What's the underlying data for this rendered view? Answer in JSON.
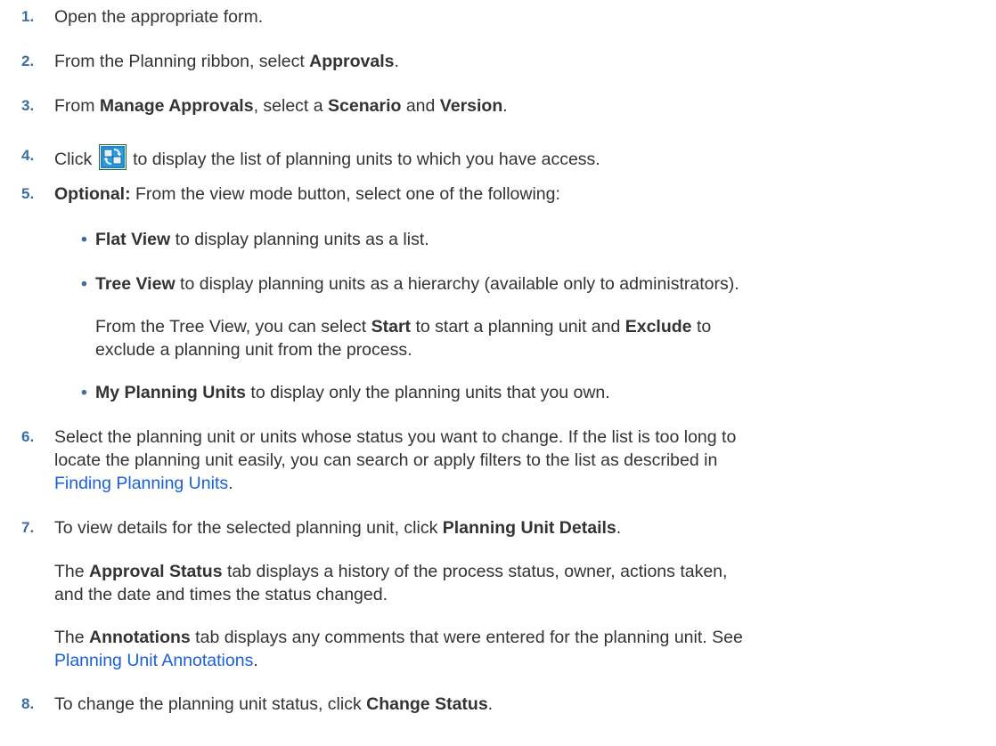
{
  "steps": [
    {
      "num": "1.",
      "text": "Open the appropriate form."
    },
    {
      "num": "2.",
      "pre": "From the Planning ribbon, select ",
      "b1": "Approvals",
      "post": "."
    },
    {
      "num": "3.",
      "pre": "From ",
      "b1": "Manage Approvals",
      "mid1": ", select a ",
      "b2": "Scenario",
      "mid2": " and ",
      "b3": "Version",
      "post": "."
    },
    {
      "num": "4.",
      "pre": "Click ",
      "post": " to display the list of planning units to which you have access.",
      "icon": "refresh-icon"
    },
    {
      "num": "5.",
      "b1": "Optional:",
      "post": " From the view mode button, select one of the following:"
    },
    {
      "num": "6.",
      "line1": "Select the planning unit or units whose status you want to change. If the list is too long to",
      "line2": "locate the planning unit easily, you can search or apply filters to the list as described in",
      "link": "Finding Planning Units",
      "post": "."
    },
    {
      "num": "7.",
      "pre": "To view details for the selected planning unit, click ",
      "b1": "Planning Unit Details",
      "post": "."
    },
    {
      "num": "8.",
      "pre": "To change the planning unit status, click ",
      "b1": "Change Status",
      "post": "."
    }
  ],
  "bullets": [
    {
      "dot": "•",
      "b1": "Flat View",
      "post": " to display planning units as a list."
    },
    {
      "dot": "•",
      "b1": "Tree View",
      "post": " to display planning units as a hierarchy (available only to administrators)."
    },
    {
      "dot": "•",
      "b1": "My Planning Units",
      "post": " to display only the planning units that you own."
    }
  ],
  "tree_note": {
    "pre": "From the Tree View, you can select ",
    "b1": "Start",
    "mid": " to start a planning unit and ",
    "b2": "Exclude",
    "line1_end": " to",
    "line2": "exclude a planning unit from the process."
  },
  "approval_note": {
    "pre": "The ",
    "b1": "Approval Status",
    "line1": " tab displays a history of the process status, owner, actions taken,",
    "line2": "and the date and times the status changed."
  },
  "annotations_note": {
    "pre": "The ",
    "b1": "Annotations",
    "line1": " tab displays any comments that were entered for the planning unit. See",
    "link": "Planning Unit Annotations",
    "post": "."
  }
}
